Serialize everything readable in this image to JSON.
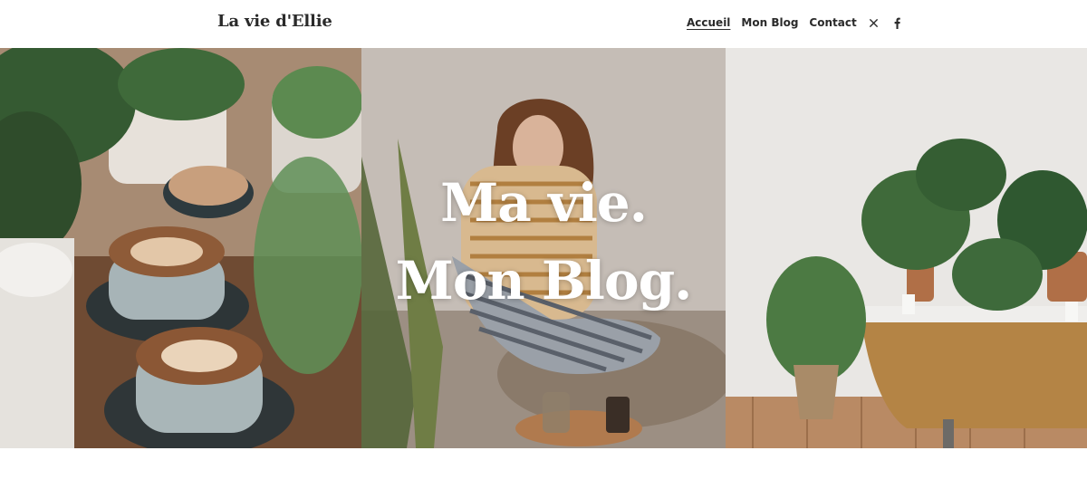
{
  "site": {
    "brand": "La vie d'Ellie"
  },
  "nav": {
    "items": [
      {
        "label": "Accueil",
        "active": true
      },
      {
        "label": "Mon Blog",
        "active": false
      },
      {
        "label": "Contact",
        "active": false
      }
    ],
    "social": [
      {
        "icon": "x-twitter-icon"
      },
      {
        "icon": "facebook-icon"
      }
    ]
  },
  "hero": {
    "line1": "Ma vie.",
    "line2": "Mon Blog.",
    "images": [
      {
        "icon": "coffee-plants-photo"
      },
      {
        "icon": "woman-sitting-photo"
      },
      {
        "icon": "plants-bathtub-photo"
      }
    ]
  },
  "colors": {
    "text": "#2a2a2a",
    "hero_text": "#ffffff",
    "background": "#ffffff"
  }
}
